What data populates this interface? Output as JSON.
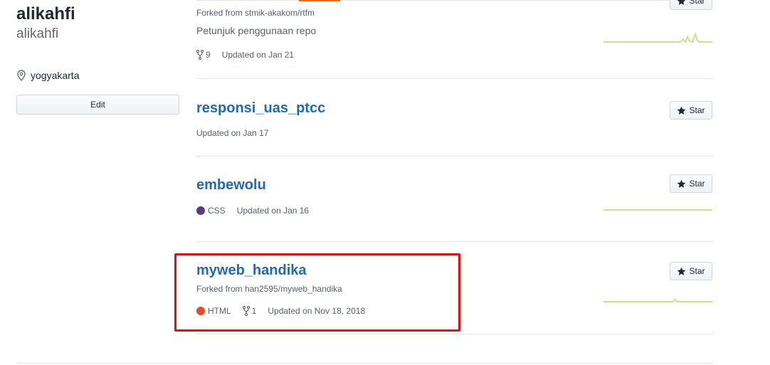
{
  "profile": {
    "name": "alikahfi",
    "username": "alikahfi",
    "location": "yogyakarta",
    "edit_label": "Edit"
  },
  "repos": [
    {
      "forked_from": "Forked from stmik-akakom/rtfm",
      "description": "Petunjuk penggunaan repo",
      "forks": "9",
      "updated": "Updated on Jan 21",
      "star_label": "Star"
    },
    {
      "name": "responsi_uas_ptcc",
      "updated": "Updated on Jan 17",
      "star_label": "Star"
    },
    {
      "name": "embewolu",
      "language": "CSS",
      "language_color": "#563d7c",
      "updated": "Updated on Jan 16",
      "star_label": "Star"
    },
    {
      "name": "myweb_handika",
      "forked_from": "Forked from han2595/myweb_handika",
      "language": "HTML",
      "language_color": "#e34c26",
      "forks": "1",
      "updated": "Updated on Nov 18, 2018",
      "star_label": "Star"
    }
  ],
  "colors": {
    "link": "#1f6ab5",
    "highlight": "#dd1111",
    "sparkline": "#c6e48b"
  }
}
